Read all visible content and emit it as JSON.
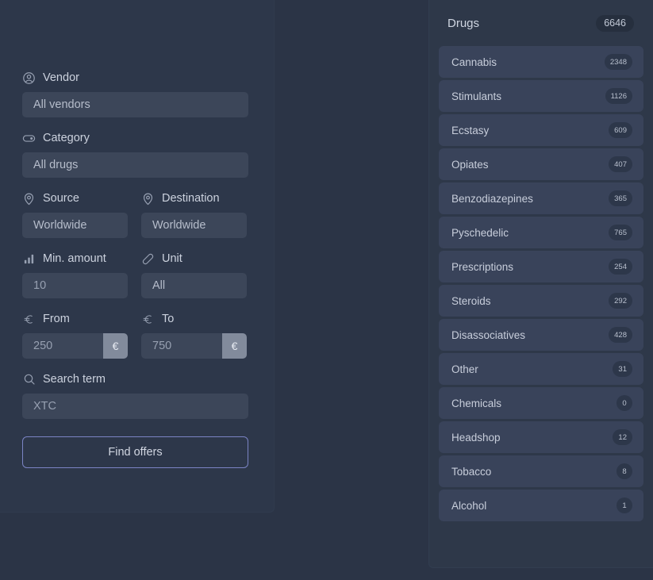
{
  "search_panel": {
    "fields": [
      {
        "key": "vendor",
        "label": "Vendor",
        "icon": "user-circle-icon",
        "value": "All vendors"
      },
      {
        "key": "category",
        "label": "Category",
        "icon": "tag-icon",
        "value": "All drugs"
      },
      {
        "key": "source",
        "label": "Source",
        "icon": "map-pin-icon",
        "value": "Worldwide"
      },
      {
        "key": "destination",
        "label": "Destination",
        "icon": "map-pin-icon",
        "value": "Worldwide"
      },
      {
        "key": "min_amount",
        "label": "Min. amount",
        "icon": "bar-chart-icon",
        "value": "10"
      },
      {
        "key": "unit",
        "label": "Unit",
        "icon": "pill-icon",
        "value": "All"
      },
      {
        "key": "from",
        "label": "From",
        "icon": "euro-icon",
        "value": "250",
        "suffix": "€"
      },
      {
        "key": "to",
        "label": "To",
        "icon": "euro-icon",
        "value": "750",
        "suffix": "€"
      },
      {
        "key": "search_term",
        "label": "Search term",
        "icon": "search-icon",
        "value": "XTC"
      }
    ],
    "submit_label": "Find offers"
  },
  "drugs_panel": {
    "title": "Drugs",
    "total": "6646",
    "categories": [
      {
        "name": "Cannabis",
        "count": "2348"
      },
      {
        "name": "Stimulants",
        "count": "1126"
      },
      {
        "name": "Ecstasy",
        "count": "609"
      },
      {
        "name": "Opiates",
        "count": "407"
      },
      {
        "name": "Benzodiazepines",
        "count": "365"
      },
      {
        "name": "Pyschedelic",
        "count": "765"
      },
      {
        "name": "Prescriptions",
        "count": "254"
      },
      {
        "name": "Steroids",
        "count": "292"
      },
      {
        "name": "Disassociatives",
        "count": "428"
      },
      {
        "name": "Other",
        "count": "31"
      },
      {
        "name": "Chemicals",
        "count": "0"
      },
      {
        "name": "Headshop",
        "count": "12"
      },
      {
        "name": "Tobacco",
        "count": "8"
      },
      {
        "name": "Alcohol",
        "count": "1"
      }
    ]
  },
  "colors": {
    "background": "#2b3446",
    "panel": "#2d374a",
    "input": "#3c4659",
    "suffix": "#828b9c",
    "accent_border": "#7b84c4",
    "row": "#39435a",
    "badge": "#2d374a"
  }
}
